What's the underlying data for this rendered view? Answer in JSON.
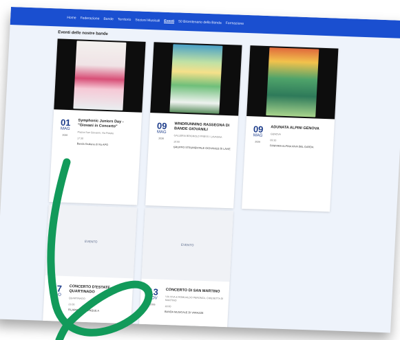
{
  "nav": {
    "items": [
      {
        "label": "Home",
        "active": false
      },
      {
        "label": "Federazione",
        "active": false
      },
      {
        "label": "Bande",
        "active": false
      },
      {
        "label": "Territorio",
        "active": false
      },
      {
        "label": "Sezioni Musicali",
        "active": false
      },
      {
        "label": "Eventi",
        "active": true
      },
      {
        "label": "50 Bicentenario della Banda",
        "active": false
      },
      {
        "label": "Formazione",
        "active": false
      }
    ],
    "bar_color": "#1a4fd0"
  },
  "page": {
    "section_title": "Eventi delle nostre bande"
  },
  "events": [
    {
      "day": "01",
      "month": "MAG",
      "year": "2026",
      "title": "Symphonic Juniors Day - \"Giovani in Concerto\"",
      "place": "Piazza San Giovanni, Via Poletto",
      "time": "17:30",
      "org": "Banda Giuliana di Via APO",
      "media": "poster"
    },
    {
      "day": "09",
      "month": "MAG",
      "year": "2026",
      "title": "WINDRUNNING RASSEGNA DI BANDE GIOVANILI",
      "place": "GALLERIA BRIGNOLO PRESS / LAVAGNA",
      "time": "10:00",
      "org": "GRUPPO STRUMENTALE GIOVANILE DI LAVIE",
      "media": "poster"
    },
    {
      "day": "09",
      "month": "MAG",
      "year": "2026",
      "title": "ADUNATA ALPINI GENOVA",
      "place": "GENOVA",
      "time": "09:30",
      "org": "FANFARA ALPINA RIVA DEL GARDA",
      "media": "poster"
    },
    {
      "day": "07",
      "month": "AGO",
      "year": "2026",
      "title": "CONCERTO D'ESTATE QUARTINADO",
      "place": "QUARTINADO",
      "time": "21:00",
      "org": "FILARMONICA CINQUE A",
      "media": "placeholder",
      "placeholder_label": "EVENTO"
    },
    {
      "day": "13",
      "month": "NOV",
      "year": "2026",
      "title": "CONCERTO DI SAN MARTINO",
      "place": "VIA VIVA & ROMUALDO PERONZA, CHIESETTA DI MARTINO",
      "time": "18:00",
      "org": "BANDA MUSICALE DI VARAZZE",
      "media": "placeholder",
      "placeholder_label": "EVENTO"
    }
  ],
  "colors": {
    "accent": "#1c3c8a",
    "scribble": "#129a5a"
  }
}
